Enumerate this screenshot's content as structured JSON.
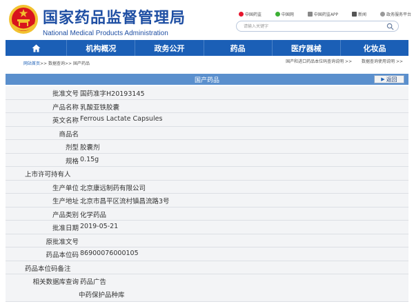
{
  "header": {
    "title_cn": "国家药品监督管理局",
    "title_en": "National Medical Products Administration",
    "top_links": [
      "中国药监",
      "中国网",
      "中国药监APP",
      "新闻",
      "政务服务平台"
    ],
    "search_placeholder": "请输入关键字"
  },
  "nav": {
    "items": [
      "机构概况",
      "政务公开",
      "药品",
      "医疗器械",
      "化妆品"
    ]
  },
  "breadcrumb": {
    "home": "网站首页",
    "rest": ">> 数据查询>> 国产药品"
  },
  "right_links": [
    "国产和进口药品本位码查询说明 >>",
    "数据查询使用说明 >>"
  ],
  "titlebar": {
    "title": "国产药品",
    "back_label": "返回"
  },
  "fields": [
    {
      "label": "批准文号",
      "value": "国药准字H20193145"
    },
    {
      "label": "产品名称",
      "value": "乳酸亚铁胶囊"
    },
    {
      "label": "英文名称",
      "value": "Ferrous Lactate Capsules"
    },
    {
      "label": "商品名",
      "value": ""
    },
    {
      "label": "剂型",
      "value": "胶囊剂"
    },
    {
      "label": "规格",
      "value": "0.15g"
    },
    {
      "label": "上市许可持有人",
      "value": ""
    },
    {
      "label": "生产单位",
      "value": "北京康远制药有限公司"
    },
    {
      "label": "生产地址",
      "value": "北京市昌平区流村镇昌流路3号"
    },
    {
      "label": "产品类别",
      "value": "化学药品"
    },
    {
      "label": "批准日期",
      "value": "2019-05-21"
    },
    {
      "label": "原批准文号",
      "value": ""
    },
    {
      "label": "药品本位码",
      "value": "86900076000105"
    },
    {
      "label": "药品本位码备注",
      "value": ""
    },
    {
      "label": "相关数据库查询",
      "value": "药品广告",
      "value2": "中药保护品种库"
    }
  ],
  "colors": {
    "nav_bg": "#1b5fb6",
    "titlebar_bg": "#5a8fcd",
    "brand_blue": "#1f4fa3",
    "emblem_red": "#d8141d",
    "emblem_gold": "#f2c230"
  }
}
